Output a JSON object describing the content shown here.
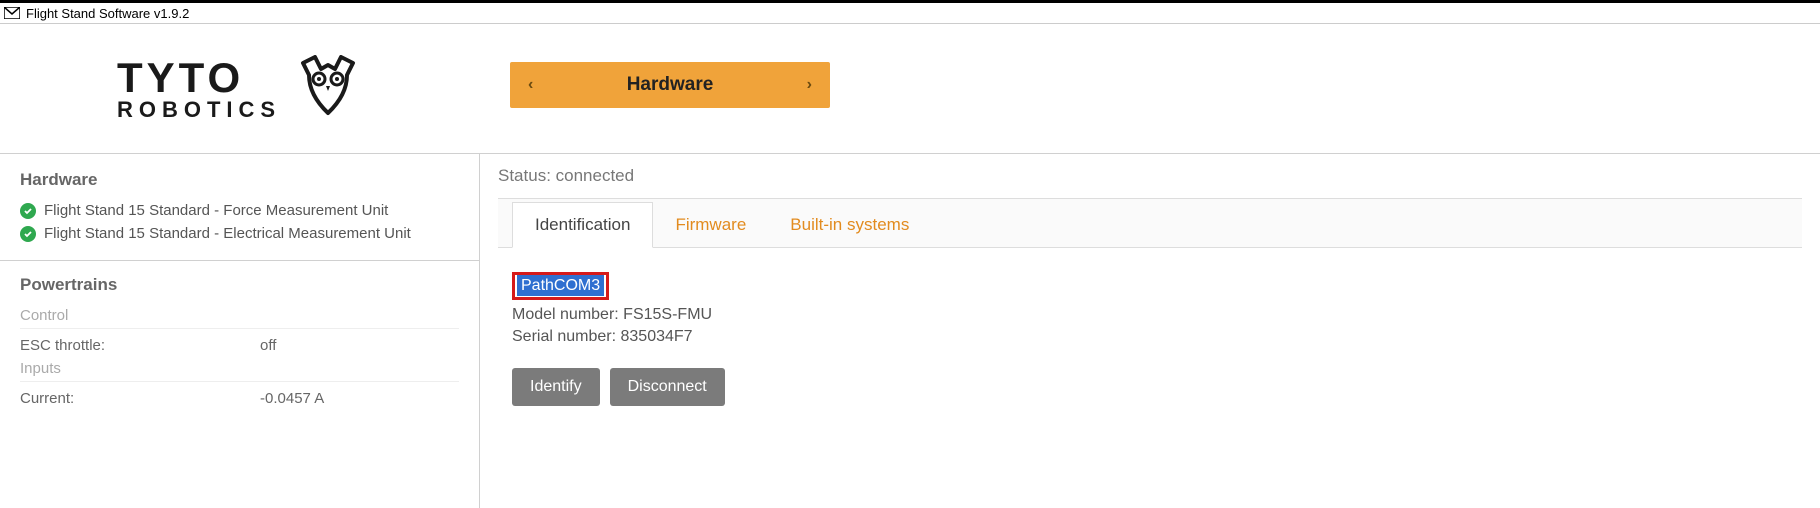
{
  "window": {
    "title": "Flight Stand Software v1.9.2"
  },
  "nav": {
    "prev": "‹",
    "label": "Hardware",
    "next": "›"
  },
  "sidebar": {
    "hardware_heading": "Hardware",
    "hw_items": [
      "Flight Stand 15 Standard - Force Measurement Unit",
      "Flight Stand 15 Standard - Electrical Measurement Unit"
    ],
    "powertrains_heading": "Powertrains",
    "control_label": "Control",
    "esc_throttle_label": "ESC throttle:",
    "esc_throttle_value": "off",
    "inputs_label": "Inputs",
    "current_label": "Current:",
    "current_value": "-0.0457 A"
  },
  "main": {
    "status_line": "Status: connected",
    "tabs": [
      {
        "label": "Identification"
      },
      {
        "label": "Firmware"
      },
      {
        "label": "Built-in systems"
      }
    ],
    "identification": {
      "path_label": "PathCOM3",
      "model_label": "Model number: ",
      "model_value": "FS15S-FMU",
      "serial_label": "Serial number: ",
      "serial_value": "835034F7",
      "identify_btn": "Identify",
      "disconnect_btn": "Disconnect"
    }
  }
}
